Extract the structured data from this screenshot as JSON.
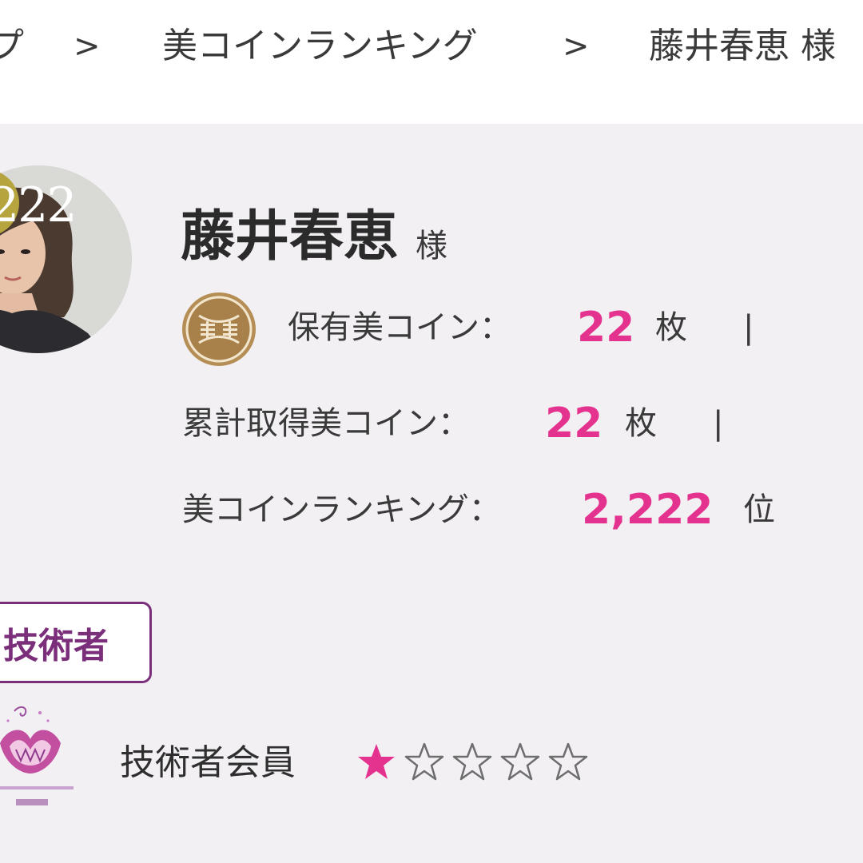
{
  "breadcrumb": {
    "items": [
      {
        "label": "プ"
      },
      {
        "label": "美コインランキング"
      },
      {
        "label": "藤井春恵 様"
      }
    ],
    "separator": ">"
  },
  "profile": {
    "avatar_badge_text": "222",
    "name": "藤井春恵",
    "honorific": "様",
    "coin_icon": "bi-coin-icon"
  },
  "stats": {
    "held": {
      "label": "保有美コイン：",
      "value": "22",
      "unit": "枚",
      "separator": "|"
    },
    "cumulative": {
      "label": "累計取得美コイン：",
      "value": "22",
      "unit": "枚",
      "separator": "|"
    },
    "ranking": {
      "label": "美コインランキング：",
      "value": "2,222",
      "unit": "位"
    }
  },
  "membership": {
    "tag": "技術者",
    "member_type": "技術者会員",
    "rating": 1,
    "rating_max": 5
  },
  "colors": {
    "accent_pink": "#e4338f",
    "tag_purple": "#7b2f7a",
    "panel_bg": "#f3f0f4",
    "coin_gold": "#a8804a"
  }
}
